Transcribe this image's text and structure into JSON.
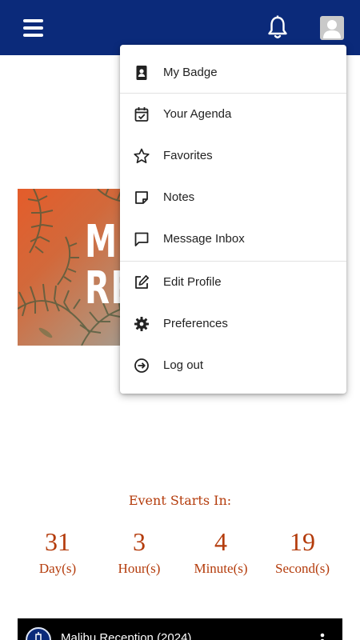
{
  "topbar": {
    "menu_icon": "hamburger-icon",
    "notifications_icon": "bell-icon",
    "avatar_icon": "user-icon",
    "bg_color": "#0b2a7a"
  },
  "hero": {
    "line1": "M",
    "line2": "RE"
  },
  "user_menu": {
    "items": [
      {
        "label": "My Badge",
        "icon": "badge-icon"
      },
      {
        "label": "Your Agenda",
        "icon": "calendar-check-icon"
      },
      {
        "label": "Favorites",
        "icon": "star-icon"
      },
      {
        "label": "Notes",
        "icon": "note-icon"
      },
      {
        "label": "Message Inbox",
        "icon": "chat-bubble-icon"
      },
      {
        "label": "Edit Profile",
        "icon": "edit-icon"
      },
      {
        "label": "Preferences",
        "icon": "gear-icon"
      },
      {
        "label": "Log out",
        "icon": "logout-icon"
      }
    ]
  },
  "countdown": {
    "title": "Event Starts In:",
    "days": {
      "value": "31",
      "unit": "Day(s)"
    },
    "hours": {
      "value": "3",
      "unit": "Hour(s)"
    },
    "minutes": {
      "value": "4",
      "unit": "Minute(s)"
    },
    "seconds": {
      "value": "19",
      "unit": "Second(s)"
    },
    "color": "#b43c0c"
  },
  "bottom_card": {
    "title": "Malibu Reception (2024)",
    "menu_icon": "more-vertical-icon"
  }
}
